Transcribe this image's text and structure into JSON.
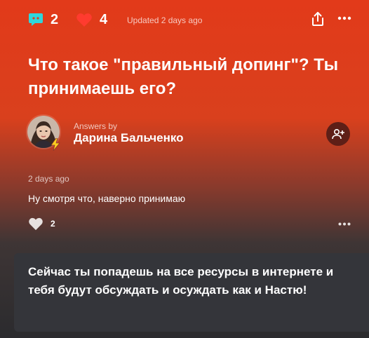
{
  "header": {
    "comments_count": "2",
    "likes_count": "4",
    "updated_text": "Updated 2 days ago"
  },
  "question": {
    "title": "Что такое \"правильный допинг\"? Ты принимаешь его?"
  },
  "author": {
    "answers_by_label": "Answers by",
    "name": "Дарина Бальченко"
  },
  "answer": {
    "time": "2 days ago",
    "text": "Ну смотря что, наверно принимаю",
    "likes": "2"
  },
  "promo": {
    "text": "Сейчас ты попадешь на все ресурсы в интернете и тебя будут обсуждать и осуждать как и Настю!"
  },
  "colors": {
    "accent_teal": "#2fd6dc",
    "like_red": "#ff3b2f",
    "follow_bg": "#5e1f17",
    "card_bg": "#34353a"
  },
  "icons": {
    "comments": "chat-bubble-icon",
    "likes": "heart-icon",
    "share": "share-icon",
    "more": "more-dots-icon",
    "follow": "add-person-icon",
    "badge": "lightning-icon"
  }
}
